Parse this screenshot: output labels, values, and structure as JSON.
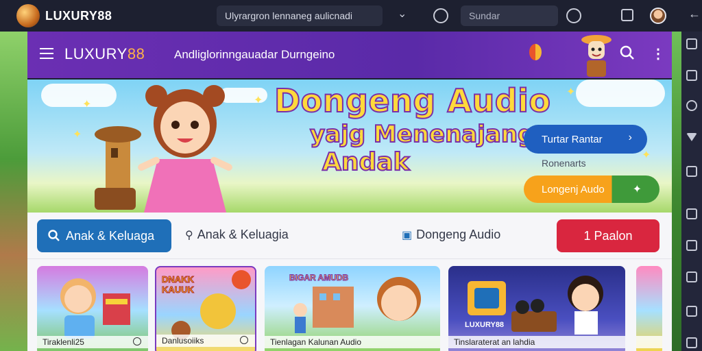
{
  "browser": {
    "brand": "LUXURY88",
    "url_text": "Ulyrargron lennaneg aulicnadi",
    "search_placeholder": "Sundar"
  },
  "app": {
    "brand_word": "LUXURY",
    "brand_num": "88",
    "subtitle": "Andliglorinngauadar Durngeino"
  },
  "hero": {
    "title_line1": "Dongeng Audio",
    "title_line2": "yajg Menenajang",
    "title_line3": "Andak",
    "play_button": "Turtar Rantar",
    "play_arrow": "›",
    "small_text": "Ronenarts",
    "audio_button": "Longenj Audo",
    "audio_arrow": "✦"
  },
  "categories": {
    "active": "Anak & Keluaga",
    "second": "Anak & Keluagia",
    "third": "Dongeng Audio",
    "red": "1 Paalon"
  },
  "cards": [
    {
      "caption": "Tiraklenli25"
    },
    {
      "caption": "Danlusoiiks",
      "art_text": "DNAKK KAUUK"
    },
    {
      "caption": "Tienlagan Kalunan Audio",
      "art_text": "BIGAR AMUDB"
    },
    {
      "caption": "Tinslaraterat an lahdia",
      "art_text": "LUXURY88"
    },
    {
      "caption": ""
    }
  ],
  "colors": {
    "chrome_bg": "#1d2030",
    "header_purple": "#6b2fb3",
    "primary_blue": "#1f6fb8",
    "accent_red": "#d9263f",
    "accent_orange": "#f7a21b",
    "title_yellow": "#ffd93b"
  }
}
